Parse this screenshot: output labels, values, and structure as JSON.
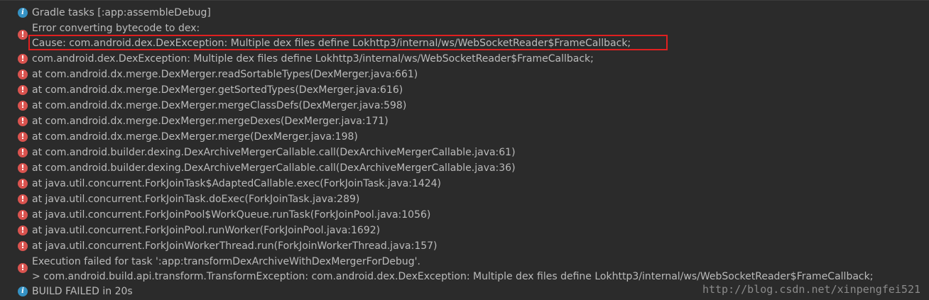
{
  "lines": [
    {
      "icon": "info",
      "text": "Gradle tasks [:app:assembleDebug]"
    },
    {
      "icon": "error",
      "text": "Error converting bytecode to dex:"
    },
    {
      "icon": "none",
      "text": "Cause: com.android.dex.DexException: Multiple dex files define Lokhttp3/internal/ws/WebSocketReader$FrameCallback;"
    },
    {
      "icon": "error",
      "text": "com.android.dex.DexException: Multiple dex files define Lokhttp3/internal/ws/WebSocketReader$FrameCallback;"
    },
    {
      "icon": "error",
      "text": "at com.android.dx.merge.DexMerger.readSortableTypes(DexMerger.java:661)"
    },
    {
      "icon": "error",
      "text": "at com.android.dx.merge.DexMerger.getSortedTypes(DexMerger.java:616)"
    },
    {
      "icon": "error",
      "text": "at com.android.dx.merge.DexMerger.mergeClassDefs(DexMerger.java:598)"
    },
    {
      "icon": "error",
      "text": "at com.android.dx.merge.DexMerger.mergeDexes(DexMerger.java:171)"
    },
    {
      "icon": "error",
      "text": "at com.android.dx.merge.DexMerger.merge(DexMerger.java:198)"
    },
    {
      "icon": "error",
      "text": "at com.android.builder.dexing.DexArchiveMergerCallable.call(DexArchiveMergerCallable.java:61)"
    },
    {
      "icon": "error",
      "text": "at com.android.builder.dexing.DexArchiveMergerCallable.call(DexArchiveMergerCallable.java:36)"
    },
    {
      "icon": "error",
      "text": "at java.util.concurrent.ForkJoinTask$AdaptedCallable.exec(ForkJoinTask.java:1424)"
    },
    {
      "icon": "error",
      "text": "at java.util.concurrent.ForkJoinTask.doExec(ForkJoinTask.java:289)"
    },
    {
      "icon": "error",
      "text": "at java.util.concurrent.ForkJoinPool$WorkQueue.runTask(ForkJoinPool.java:1056)"
    },
    {
      "icon": "error",
      "text": "at java.util.concurrent.ForkJoinPool.runWorker(ForkJoinPool.java:1692)"
    },
    {
      "icon": "error",
      "text": "at java.util.concurrent.ForkJoinWorkerThread.run(ForkJoinWorkerThread.java:157)"
    },
    {
      "icon": "error",
      "text": "Execution failed for task ':app:transformDexArchiveWithDexMergerForDebug'."
    },
    {
      "icon": "none",
      "text": "> com.android.build.api.transform.TransformException: com.android.dex.DexException: Multiple dex files define Lokhttp3/internal/ws/WebSocketReader$FrameCallback;"
    },
    {
      "icon": "info",
      "text": "BUILD FAILED in 20s"
    }
  ],
  "watermark": "http://blog.csdn.net/xinpengfei521",
  "colors": {
    "background": "#2b2b2b",
    "text": "#bbbbbb",
    "info_icon": "#3592c4",
    "error_icon": "#d9534f",
    "highlight_border": "#e02020"
  }
}
